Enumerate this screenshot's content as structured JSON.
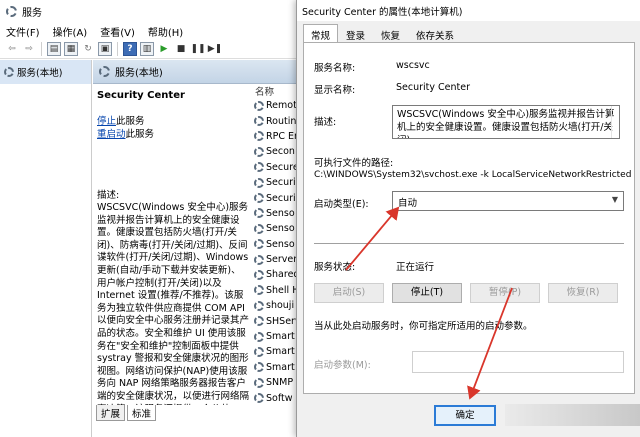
{
  "services_window": {
    "title": "服务",
    "menu": [
      "文件(F)",
      "操作(A)",
      "查看(V)",
      "帮助(H)"
    ],
    "toolbar_icons": [
      "back-arrow-icon",
      "forward-arrow-icon",
      "console-tree-icon",
      "properties-icon",
      "refresh-icon",
      "export-list-icon",
      "help-icon",
      "view-icon",
      "start-icon",
      "stop-icon",
      "pause-icon",
      "restart-icon"
    ],
    "tree_item": "服务(本地)",
    "main_header": "服务(本地)",
    "selected_service": "Security Center",
    "stop_link": "停止",
    "stop_suffix": "此服务",
    "restart_link": "重启动",
    "restart_suffix": "此服务",
    "description_label": "描述:",
    "description": "WSCSVC(Windows 安全中心)服务监视并报告计算机上的安全健康设置。健康设置包括防火墙(打开/关闭)、防病毒(打开/关闭/过期)、反间谍软件(打开/关闭/过期)、Windows 更新(自动/手动下载并安装更新)、用户帐户控制(打开/关闭)以及 Internet 设置(推荐/不推荐)。该服务为独立软件供应商提供 COM API 以便向安全中心服务注册并记录其产品的状态。安全和维护 UI 使用该服务在\"安全和维护\"控制面板中提供 systray 警报和安全健康状况的图形视图。网络访问保护(NAP)使用该服务向 NAP 网络策略服务器报告客户端的安全健康状况，以便进行网络隔离决策。该服务还提供一个公共 API，以允许外部客户以编程方式检索系统的聚合安全健康状况。",
    "list_header": "名称",
    "list_items": [
      "Remot",
      "Routin",
      "RPC Er",
      "Secon",
      "Secure",
      "Securi",
      "Securi",
      "Senso",
      "Senso",
      "Senso",
      "Server",
      "Shared",
      "Shell H",
      "shouji",
      "SHServ",
      "Smart",
      "Smart",
      "Smart",
      "SNMP",
      "Softw"
    ],
    "tabs": [
      "扩展",
      "标准"
    ]
  },
  "dialog": {
    "title": "Security Center 的属性(本地计算机)",
    "tabs": [
      "常规",
      "登录",
      "恢复",
      "依存关系"
    ],
    "service_name_label": "服务名称:",
    "service_name": "wscsvc",
    "display_name_label": "显示名称:",
    "display_name": "Security Center",
    "description_label": "描述:",
    "description": "WSCSVC(Windows 安全中心)服务监视并报告计算机上的安全健康设置。健康设置包括防火墙(打开/关闭)",
    "exe_path_label": "可执行文件的路径:",
    "exe_path": "C:\\WINDOWS\\System32\\svchost.exe -k LocalServiceNetworkRestricted",
    "startup_type_label": "启动类型(E):",
    "startup_type": "自动",
    "status_label": "服务状态:",
    "status": "正在运行",
    "buttons": {
      "start": "启动(S)",
      "stop": "停止(T)",
      "pause": "暂停(P)",
      "resume": "恢复(R)"
    },
    "hint": "当从此处启动服务时，你可指定所适用的启动参数。",
    "params_label": "启动参数(M):",
    "params_value": "",
    "ok": "确定"
  },
  "annotation_color": "#d9362b"
}
